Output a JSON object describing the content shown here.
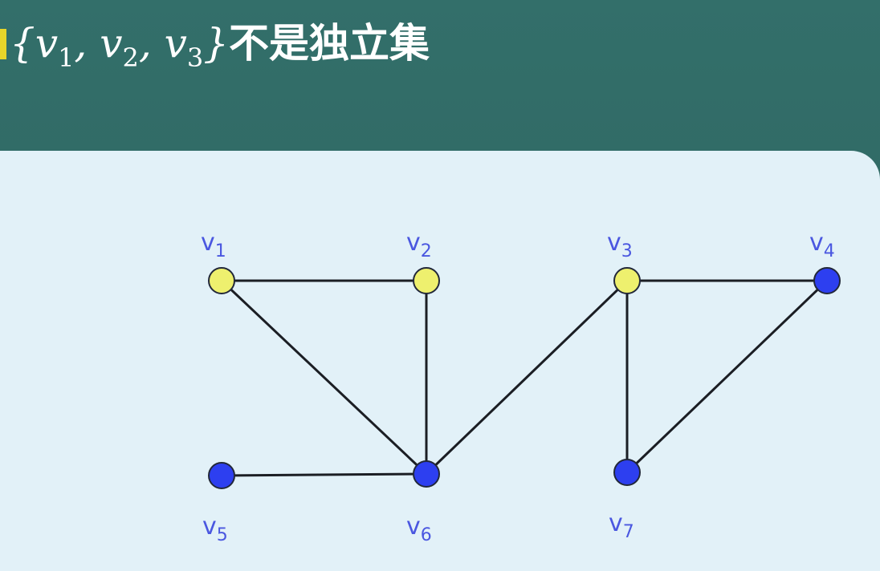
{
  "title": {
    "set_open": "{",
    "v1": "v",
    "v1_sub": "1",
    "sep1": ", ",
    "v2": "v",
    "v2_sub": "2",
    "sep2": ", ",
    "v3": "v",
    "v3_sub": "3",
    "set_close": "}",
    "text": "不是独立集"
  },
  "colors": {
    "selected_vertex": "#eef06e",
    "other_vertex": "#2d3ff0",
    "edge": "#1b1e24",
    "label": "#4a57e0"
  },
  "graph": {
    "vertices": [
      {
        "id": "v1",
        "letter": "v",
        "sub": "1",
        "selected": true
      },
      {
        "id": "v2",
        "letter": "v",
        "sub": "2",
        "selected": true
      },
      {
        "id": "v3",
        "letter": "v",
        "sub": "3",
        "selected": true
      },
      {
        "id": "v4",
        "letter": "v",
        "sub": "4",
        "selected": false
      },
      {
        "id": "v5",
        "letter": "v",
        "sub": "5",
        "selected": false
      },
      {
        "id": "v6",
        "letter": "v",
        "sub": "6",
        "selected": false
      },
      {
        "id": "v7",
        "letter": "v",
        "sub": "7",
        "selected": false
      }
    ],
    "edges": [
      [
        "v1",
        "v2"
      ],
      [
        "v1",
        "v6"
      ],
      [
        "v2",
        "v6"
      ],
      [
        "v3",
        "v4"
      ],
      [
        "v3",
        "v6"
      ],
      [
        "v3",
        "v7"
      ],
      [
        "v4",
        "v7"
      ],
      [
        "v5",
        "v6"
      ]
    ]
  }
}
